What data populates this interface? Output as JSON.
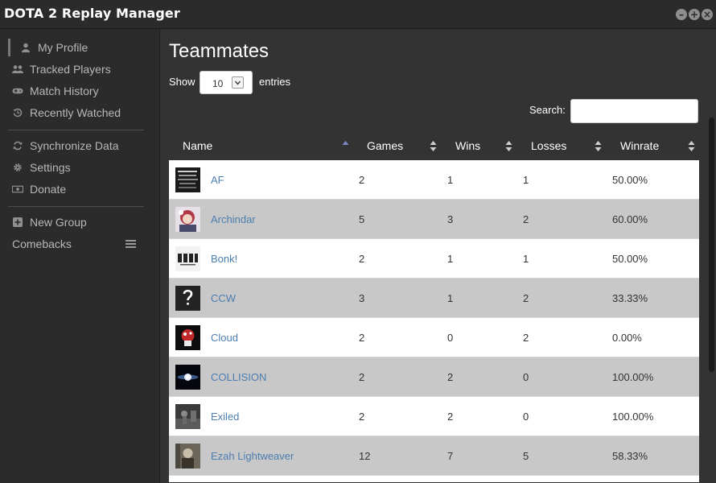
{
  "app": {
    "title": "DOTA 2 Replay Manager"
  },
  "sidebar": {
    "items": [
      {
        "label": "My Profile",
        "icon": "user-icon"
      },
      {
        "label": "Tracked Players",
        "icon": "users-icon"
      },
      {
        "label": "Match History",
        "icon": "gamepad-icon"
      },
      {
        "label": "Recently Watched",
        "icon": "history-icon"
      },
      {
        "label": "Synchronize Data",
        "icon": "refresh-icon"
      },
      {
        "label": "Settings",
        "icon": "gear-icon"
      },
      {
        "label": "Donate",
        "icon": "money-icon"
      },
      {
        "label": "New Group",
        "icon": "plus-square-icon"
      },
      {
        "label": "Comebacks",
        "icon": "menu-icon"
      }
    ]
  },
  "main": {
    "title": "Teammates",
    "show_label": "Show",
    "entries_per_page": "10",
    "entries_label": "entries",
    "search_label": "Search:",
    "search_value": "",
    "columns": [
      "Name",
      "Games",
      "Wins",
      "Losses",
      "Winrate"
    ],
    "rows": [
      {
        "name": "AF",
        "games": "2",
        "wins": "1",
        "losses": "1",
        "winrate": "50.00%"
      },
      {
        "name": "Archindar",
        "games": "5",
        "wins": "3",
        "losses": "2",
        "winrate": "60.00%"
      },
      {
        "name": "Bonk!",
        "games": "2",
        "wins": "1",
        "losses": "1",
        "winrate": "50.00%"
      },
      {
        "name": "CCW",
        "games": "3",
        "wins": "1",
        "losses": "2",
        "winrate": "33.33%"
      },
      {
        "name": "Cloud",
        "games": "2",
        "wins": "0",
        "losses": "2",
        "winrate": "0.00%"
      },
      {
        "name": "COLLISION",
        "games": "2",
        "wins": "2",
        "losses": "0",
        "winrate": "100.00%"
      },
      {
        "name": "Exiled",
        "games": "2",
        "wins": "2",
        "losses": "0",
        "winrate": "100.00%"
      },
      {
        "name": "Ezah Lightweaver",
        "games": "12",
        "wins": "7",
        "losses": "5",
        "winrate": "58.33%"
      }
    ]
  },
  "colors": {
    "link": "#4d7eb0",
    "row_alt": "#c8c8c8",
    "sidebar_bg": "#2b2b2b",
    "main_bg": "#333333"
  }
}
